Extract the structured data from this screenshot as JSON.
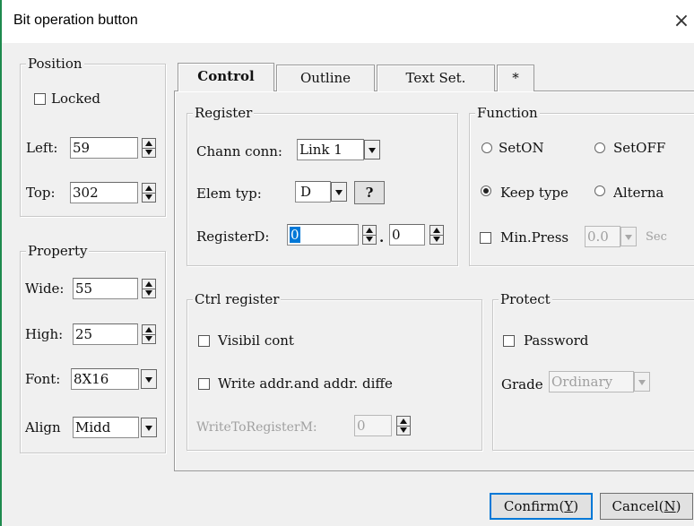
{
  "window": {
    "title": "Bit operation button",
    "close_glyph": "×",
    "accent": "#0078d7",
    "left_edge_color": "#1e8a4e"
  },
  "position": {
    "legend": "Position",
    "locked_label": "Locked",
    "locked_checked": false,
    "left_label": "Left:",
    "left_value": "59",
    "top_label": "Top:",
    "top_value": "302"
  },
  "property": {
    "legend": "Property",
    "wide_label": "Wide:",
    "wide_value": "55",
    "high_label": "High:",
    "high_value": "25",
    "font_label": "Font:",
    "font_value": "8X16",
    "align_label": "Align",
    "align_value": "Midd"
  },
  "tabs": [
    {
      "label": "Control",
      "active": true
    },
    {
      "label": "Outline",
      "active": false
    },
    {
      "label": "Text Set.",
      "active": false
    },
    {
      "label": "*",
      "active": false
    }
  ],
  "register": {
    "legend": "Register",
    "chann_label": "Chann conn:",
    "chann_value": "Link 1",
    "elem_label": "Elem typ:",
    "elem_value": "D",
    "help_label": "?",
    "reg_label": "RegisterD:",
    "reg_value": "0",
    "dot": ".",
    "bit_value": "0"
  },
  "function": {
    "legend": "Function",
    "seton_label": "SetON",
    "setoff_label": "SetOFF",
    "keep_label": "Keep type",
    "alternate_label": "Alterna",
    "selected": "Keep type",
    "minpress_label": "Min.Press",
    "minpress_value": "0.0",
    "sec_label": "Sec"
  },
  "ctrl_register": {
    "legend": "Ctrl register",
    "visibil_label": "Visibil cont",
    "write_label": "Write addr.and addr. diffe",
    "writeto_label": "WriteToRegisterM:",
    "writeto_value": "0"
  },
  "protect": {
    "legend": "Protect",
    "password_label": "Password",
    "grade_label": "Grade",
    "grade_value": "Ordinary"
  },
  "buttons": {
    "confirm_text": "Confirm(",
    "confirm_key": "Y",
    "confirm_end": ")",
    "cancel_text": "Cancel(",
    "cancel_key": "N",
    "cancel_end": ")"
  }
}
